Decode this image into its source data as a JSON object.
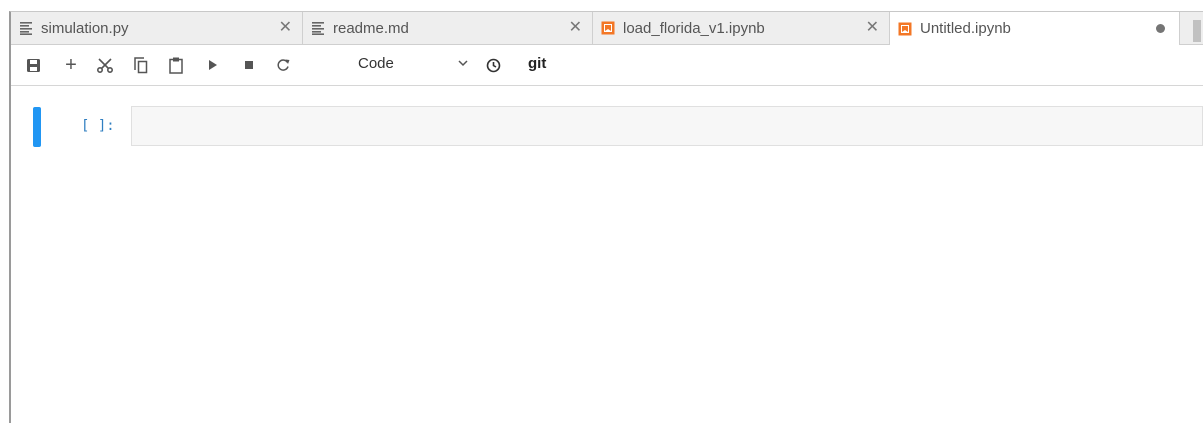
{
  "tabs": [
    {
      "label": "simulation.py",
      "icon": "text-file-icon",
      "state": "close"
    },
    {
      "label": "readme.md",
      "icon": "text-file-icon",
      "state": "close"
    },
    {
      "label": "load_florida_v1.ipynb",
      "icon": "notebook-icon",
      "state": "close"
    },
    {
      "label": "Untitled.ipynb",
      "icon": "notebook-icon",
      "state": "unsaved",
      "active": true
    }
  ],
  "toolbar": {
    "buttons": [
      "save-icon",
      "plus-icon",
      "cut-icon",
      "copy-icon",
      "paste-icon",
      "run-icon",
      "stop-icon",
      "restart-icon"
    ],
    "cell_type": "Code",
    "git_label": "git"
  },
  "cell": {
    "prompt": "[ ]:",
    "source": ""
  },
  "colors": {
    "accent": "#2196f3",
    "notebook_icon": "#f37726",
    "prompt": "#307fc1"
  }
}
